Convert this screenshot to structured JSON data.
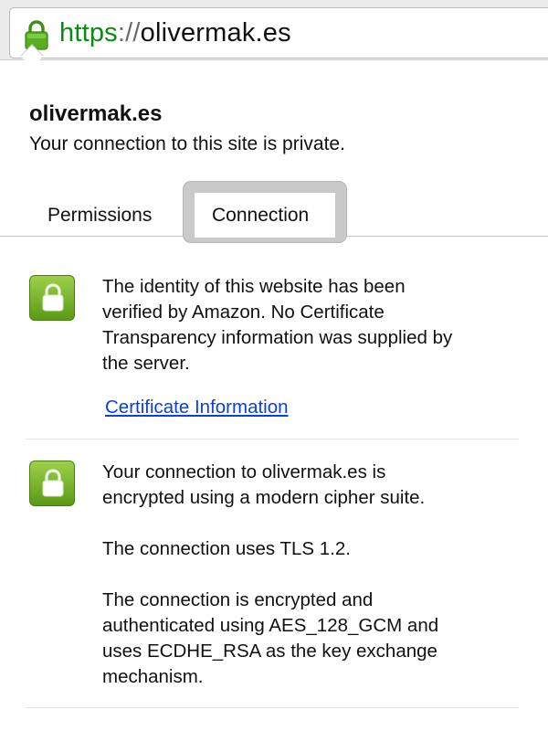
{
  "address_bar": {
    "scheme": "https",
    "separator": "://",
    "host": "olivermak.es"
  },
  "popup": {
    "site_name": "olivermak.es",
    "subtitle": "Your connection to this site is private."
  },
  "tabs": [
    {
      "label": "Permissions",
      "selected": false
    },
    {
      "label": "Connection",
      "selected": true
    }
  ],
  "identity_section": {
    "text_lines": [
      "The identity of this website has been",
      "verified by Amazon. No Certificate",
      "Transparency information was supplied by",
      "the server."
    ],
    "link_label": "Certificate Information"
  },
  "encryption_section": {
    "para1_lines": [
      "Your connection to olivermak.es is",
      "encrypted using a modern cipher suite."
    ],
    "para2": "The connection uses TLS 1.2.",
    "para3_lines": [
      "The connection is encrypted and",
      "authenticated using AES_128_GCM and",
      "uses ECDHE_RSA as the key exchange",
      "mechanism."
    ]
  },
  "colors": {
    "secure_green": "#0b8a14",
    "link_blue": "#0a3fe0",
    "lock_badge": "#6fae22"
  }
}
